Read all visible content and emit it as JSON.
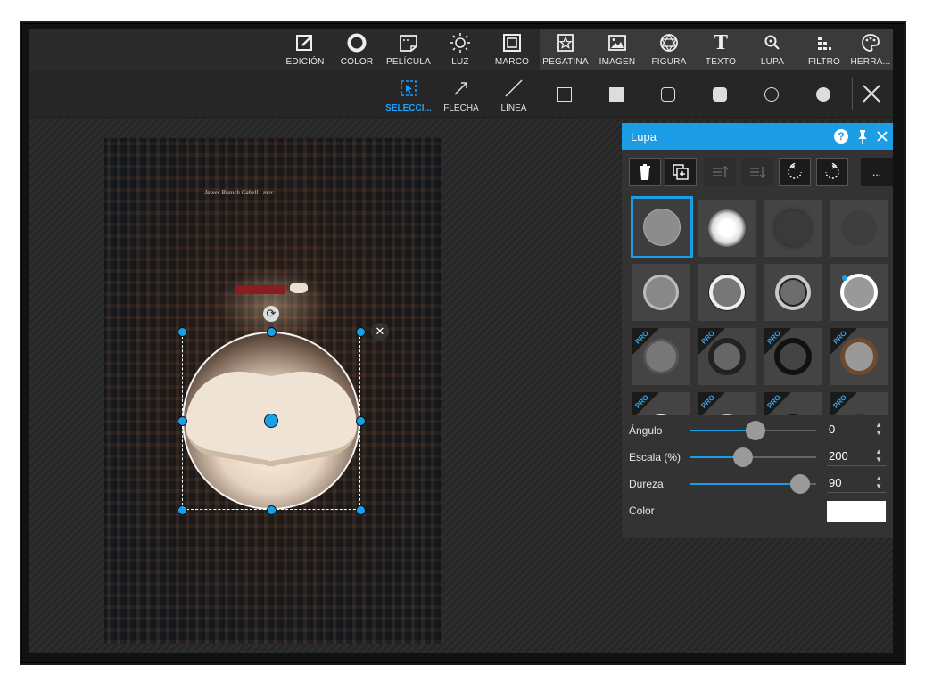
{
  "toolbar": {
    "items": [
      {
        "label": "EDICIÓN",
        "icon": "edit-icon"
      },
      {
        "label": "COLOR",
        "icon": "color-ring-icon"
      },
      {
        "label": "PELÍCULA",
        "icon": "film-icon"
      },
      {
        "label": "LUZ",
        "icon": "sun-icon"
      },
      {
        "label": "MARCO",
        "icon": "frame-icon"
      },
      {
        "label": "PEGATINA",
        "icon": "sticker-icon"
      },
      {
        "label": "IMAGEN",
        "icon": "image-icon"
      },
      {
        "label": "FIGURA",
        "icon": "shape-icon"
      },
      {
        "label": "TEXTO",
        "icon": "text-icon"
      },
      {
        "label": "LUPA",
        "icon": "magnifier-icon"
      },
      {
        "label": "FILTRO",
        "icon": "filter-icon"
      },
      {
        "label": "HERRA...",
        "icon": "palette-icon"
      }
    ]
  },
  "subtoolbar": {
    "select_label": "SELECCI...",
    "arrow_label": "FLECHA",
    "line_label": "LÍNEA"
  },
  "photo": {
    "spine_text": "James Branch Cabell - mor"
  },
  "panel": {
    "title": "Lupa",
    "more_label": "...",
    "pro_badge": "PRO",
    "sliders": [
      {
        "label": "Ángulo",
        "value": "0",
        "fraction": 0.52
      },
      {
        "label": "Escala (%)",
        "value": "200",
        "fraction": 0.42
      },
      {
        "label": "Dureza",
        "value": "90",
        "fraction": 0.87
      }
    ],
    "color_label": "Color",
    "color_value": "#ffffff"
  },
  "colors": {
    "accent": "#1d9de6",
    "panel_bg": "#333333",
    "toolbar_bg": "#2a2a2a"
  }
}
